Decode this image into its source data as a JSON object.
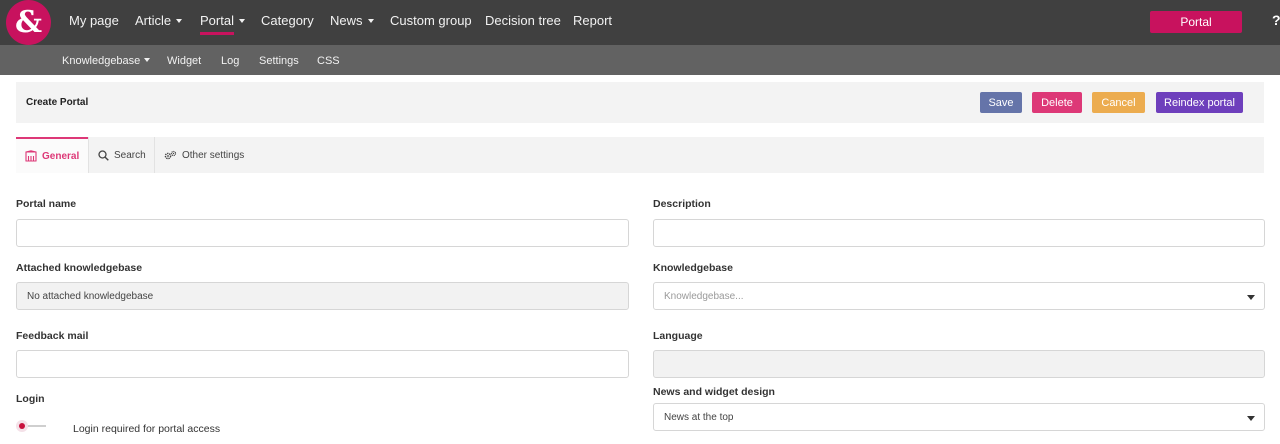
{
  "logo_text": "&",
  "nav": {
    "items": [
      {
        "label": "My page"
      },
      {
        "label": "Article",
        "dropdown": true
      },
      {
        "label": "Portal",
        "dropdown": true,
        "active": true
      },
      {
        "label": "Category"
      },
      {
        "label": "News",
        "dropdown": true
      },
      {
        "label": "Custom group"
      },
      {
        "label": "Decision tree"
      },
      {
        "label": "Report"
      }
    ],
    "portal_button": "Portal",
    "help_icon": "?"
  },
  "subnav": {
    "items": [
      {
        "label": "Knowledgebase",
        "dropdown": true
      },
      {
        "label": "Widget"
      },
      {
        "label": "Log"
      },
      {
        "label": "Settings"
      },
      {
        "label": "CSS"
      }
    ]
  },
  "header": {
    "title": "Create Portal",
    "buttons": {
      "save": "Save",
      "delete": "Delete",
      "cancel": "Cancel",
      "reindex": "Reindex portal"
    }
  },
  "tabs": [
    {
      "label": "General",
      "icon": "building-icon",
      "active": true
    },
    {
      "label": "Search",
      "icon": "search-icon"
    },
    {
      "label": "Other settings",
      "icon": "gears-icon"
    }
  ],
  "form": {
    "portal_name": {
      "label": "Portal name",
      "value": ""
    },
    "description": {
      "label": "Description",
      "value": ""
    },
    "attached_knowledgebase": {
      "label": "Attached knowledgebase",
      "value": "No attached knowledgebase"
    },
    "knowledgebase": {
      "label": "Knowledgebase",
      "placeholder": "Knowledgebase..."
    },
    "feedback_mail": {
      "label": "Feedback mail",
      "value": ""
    },
    "language": {
      "label": "Language",
      "value": ""
    },
    "login": {
      "label": "Login",
      "toggle_label": "Login required for portal access",
      "enabled": false
    },
    "news_widget_design": {
      "label": "News and widget design",
      "value": "News at the top"
    }
  },
  "colors": {
    "brand": "#c8125e",
    "topbar": "#404040",
    "subbar": "#626262",
    "save": "#6574a9",
    "delete": "#dd3877",
    "cancel": "#ecac4f",
    "reindex": "#6e3fbc"
  }
}
